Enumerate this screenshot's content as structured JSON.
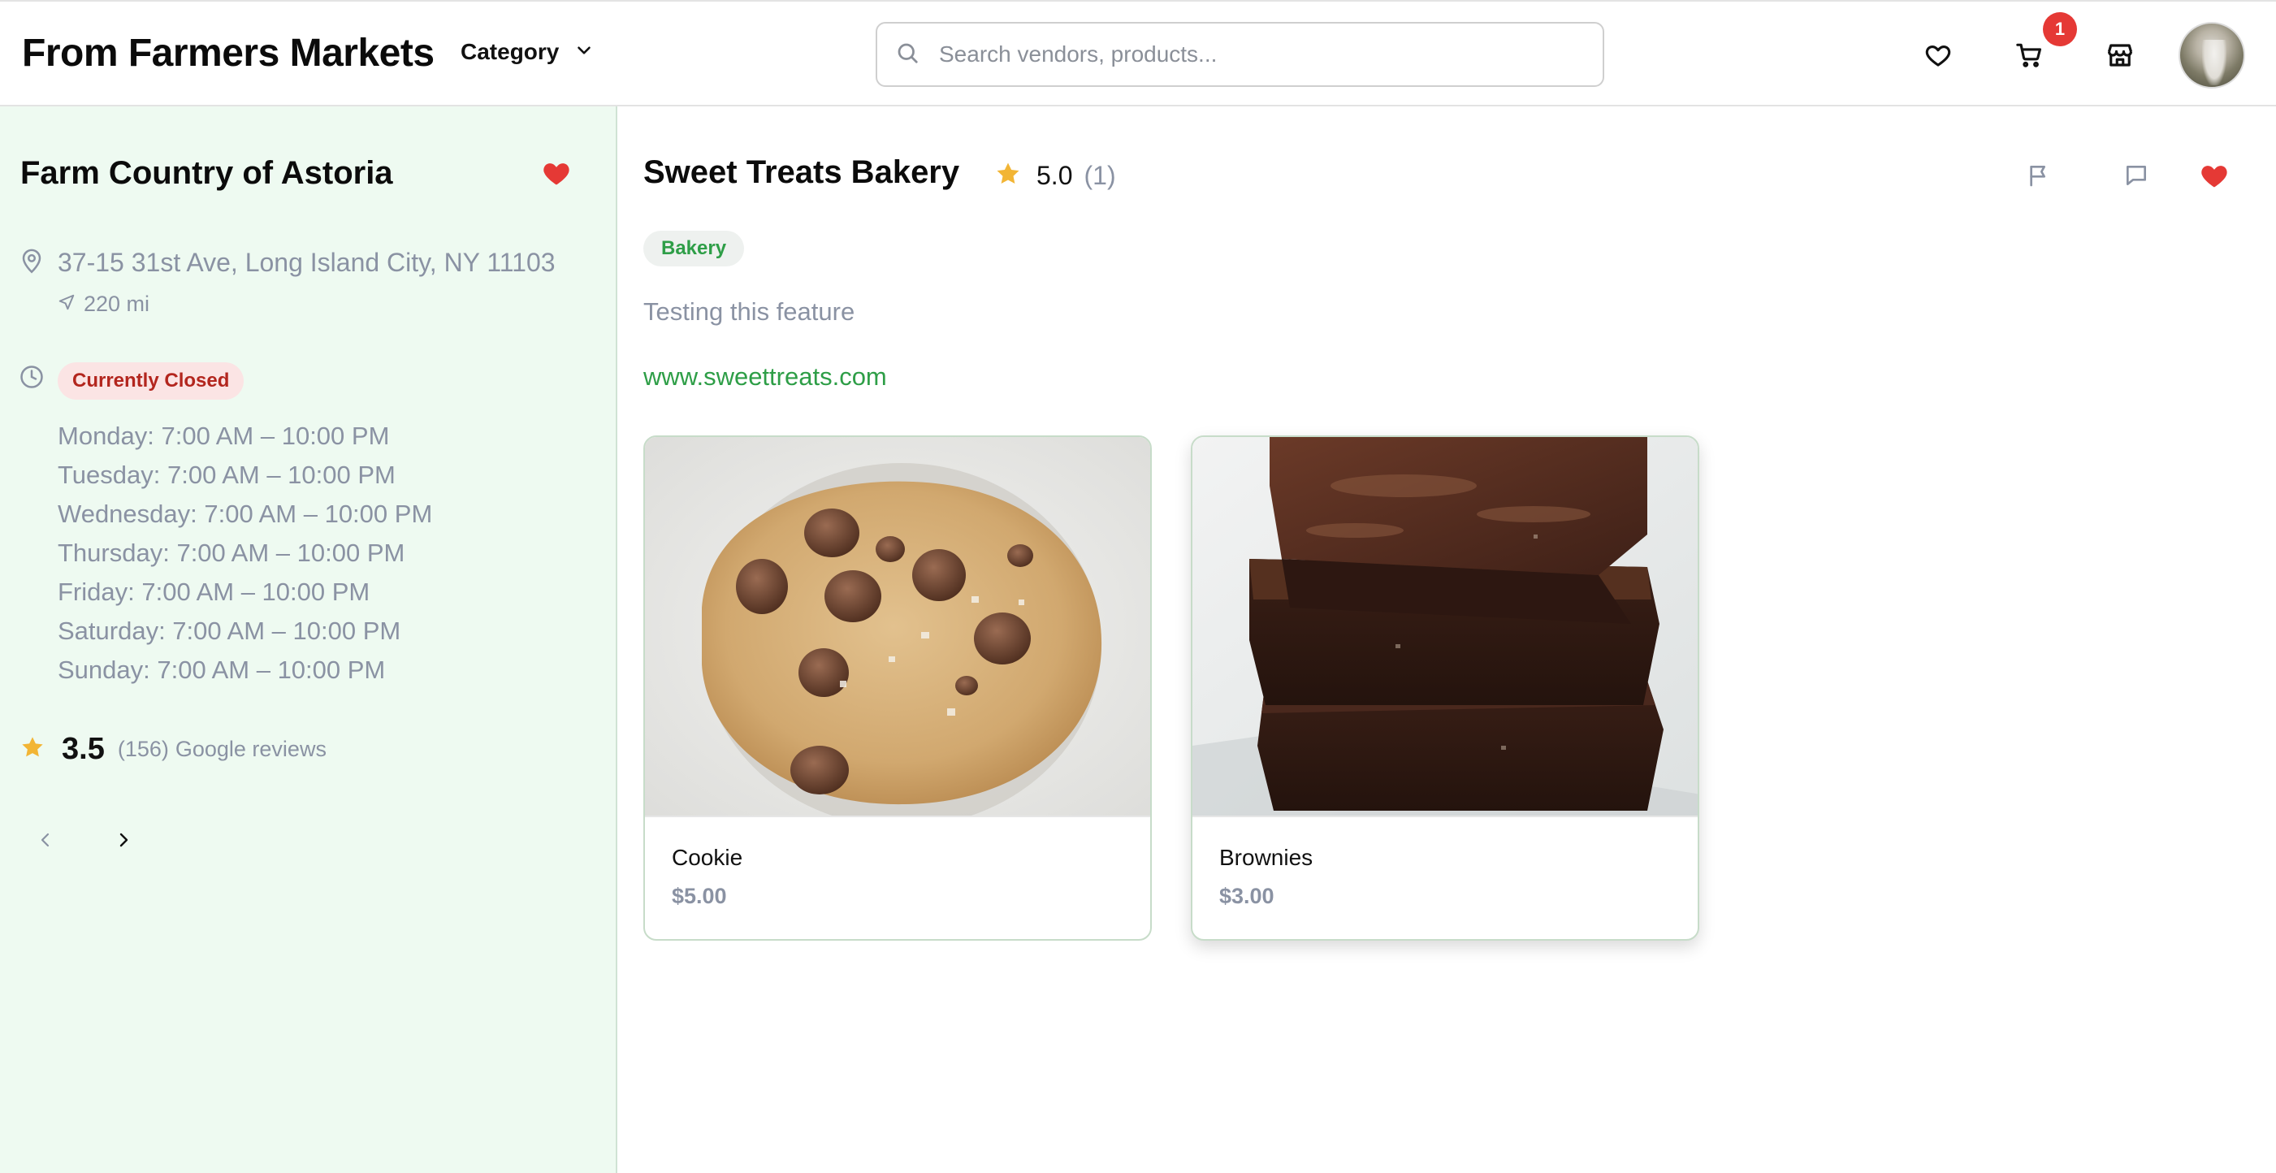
{
  "header": {
    "brand": "From Farmers Markets",
    "category_label": "Category",
    "search_placeholder": "Search vendors, products...",
    "cart_count": "1",
    "icons": [
      "heart-icon",
      "cart-icon",
      "store-icon",
      "avatar"
    ]
  },
  "market": {
    "name": "Farm Country of Astoria",
    "favorited": true,
    "address": "37-15 31st Ave, Long Island City, NY 11103",
    "distance": "220 mi",
    "status": "Currently Closed",
    "hours": [
      "Monday: 7:00 AM – 10:00 PM",
      "Tuesday: 7:00 AM – 10:00 PM",
      "Wednesday: 7:00 AM – 10:00 PM",
      "Thursday: 7:00 AM – 10:00 PM",
      "Friday: 7:00 AM – 10:00 PM",
      "Saturday: 7:00 AM – 10:00 PM",
      "Sunday: 7:00 AM – 10:00 PM"
    ],
    "rating": "3.5",
    "review_count": "(156)",
    "review_source": "Google reviews"
  },
  "vendor": {
    "name": "Sweet Treats Bakery",
    "rating": "5.0",
    "review_count": "(1)",
    "tag": "Bakery",
    "description": "Testing this feature",
    "website": "www.sweettreats.com",
    "favorited": true
  },
  "products": [
    {
      "name": "Cookie",
      "price": "$5.00",
      "image": "chocolate-chip-cookie"
    },
    {
      "name": "Brownies",
      "price": "$3.00",
      "image": "stacked-brownies"
    }
  ],
  "colors": {
    "accent_green": "#2e9e47",
    "sidebar_bg": "#eefaf1",
    "heart_red": "#e53935",
    "star_gold": "#f2b535",
    "muted_text": "#8a92a3",
    "closed_bg": "#fbe4e4",
    "closed_text": "#b3261e"
  }
}
